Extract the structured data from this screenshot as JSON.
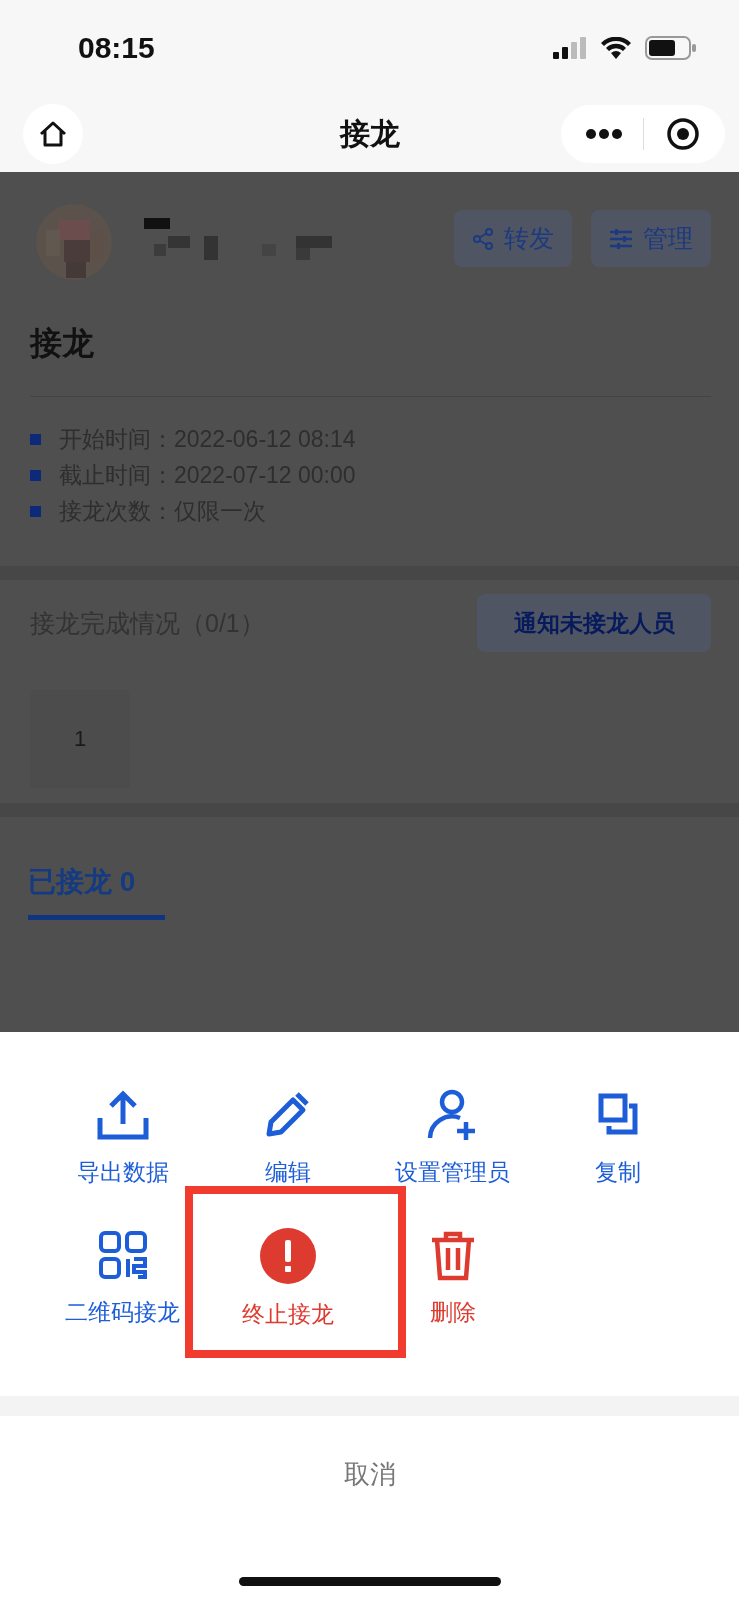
{
  "status_bar": {
    "time": "08:15"
  },
  "nav": {
    "title": "接龙"
  },
  "header": {
    "buttons": [
      {
        "kind": "share",
        "label": "转发"
      },
      {
        "kind": "manage",
        "label": "管理"
      }
    ]
  },
  "title": "接龙",
  "details": [
    "开始时间：2022-06-12 08:14",
    "截止时间：2022-07-12 00:00",
    "接龙次数：仅限一次"
  ],
  "progress": {
    "title": "接龙完成情况（0/1）",
    "notify_button": "通知未接龙人员",
    "members": [
      "1"
    ]
  },
  "tabs": [
    {
      "label": "已接龙 0",
      "selected": true
    }
  ],
  "action_sheet": {
    "actions": [
      {
        "kind": "export",
        "label": "导出数据",
        "danger": false,
        "highlighted": false
      },
      {
        "kind": "edit",
        "label": "编辑",
        "danger": false,
        "highlighted": false
      },
      {
        "kind": "add-admin",
        "label": "设置管理员",
        "danger": false,
        "highlighted": false
      },
      {
        "kind": "copy",
        "label": "复制",
        "danger": false,
        "highlighted": false
      },
      {
        "kind": "qrcode",
        "label": "二维码接龙",
        "danger": false,
        "highlighted": false
      },
      {
        "kind": "stop",
        "label": "终止接龙",
        "danger": true,
        "highlighted": true
      },
      {
        "kind": "delete",
        "label": "删除",
        "danger": true,
        "highlighted": false
      }
    ],
    "cancel": "取消"
  }
}
